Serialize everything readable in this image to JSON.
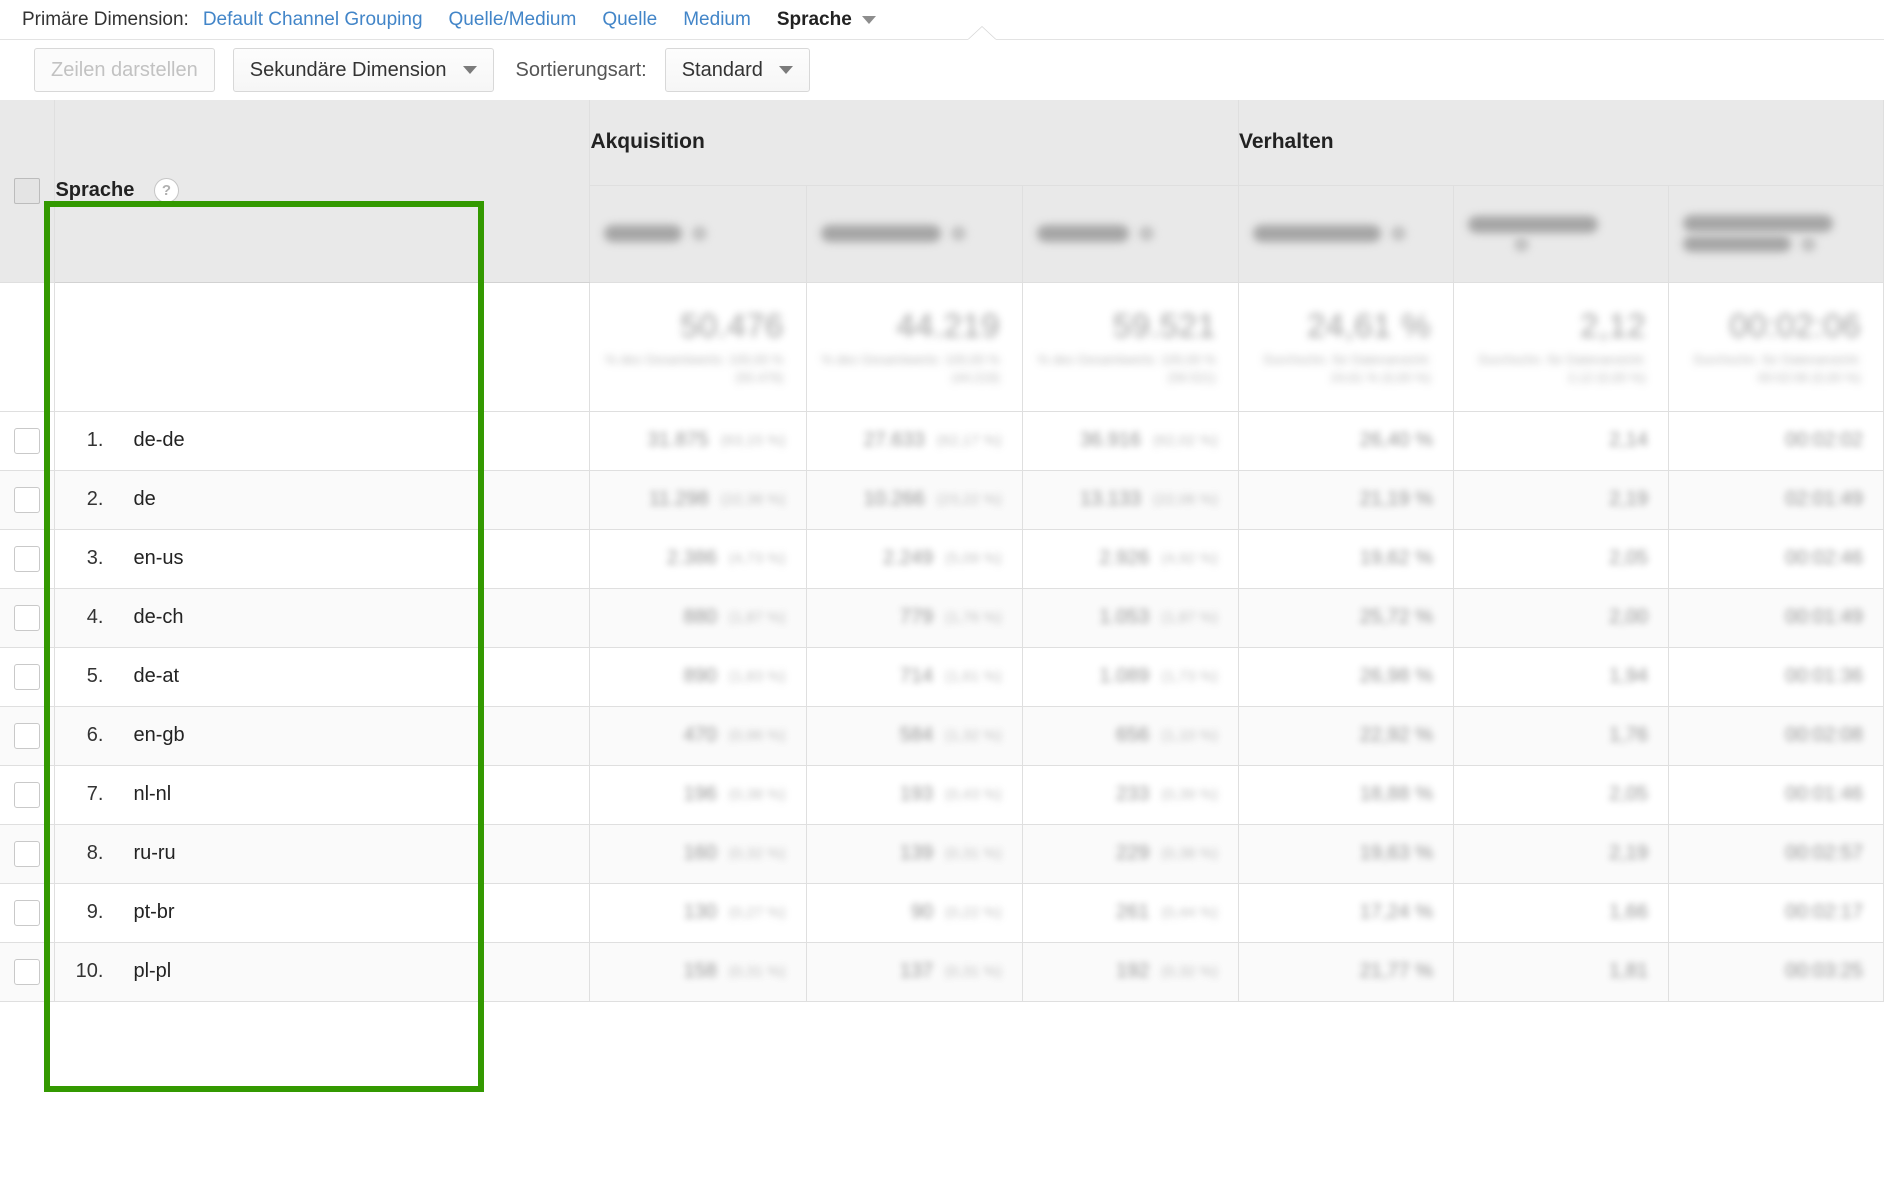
{
  "primary_dimension": {
    "label": "Primäre Dimension:",
    "links": [
      {
        "text": "Default Channel Grouping"
      },
      {
        "text": "Quelle/Medium"
      },
      {
        "text": "Quelle"
      },
      {
        "text": "Medium"
      }
    ],
    "active": "Sprache"
  },
  "toolbar": {
    "rows_button": "Zeilen darstellen",
    "secondary_dimension": "Sekundäre Dimension",
    "sort_label": "Sortierungsart:",
    "sort_value": "Standard"
  },
  "table": {
    "dimension_header": "Sprache",
    "help_glyph": "?",
    "group_headers": [
      {
        "label": "Akquisition"
      },
      {
        "label": "Verhalten"
      }
    ],
    "metric_headers": [
      {
        "name": "metric-1",
        "redacted": true
      },
      {
        "name": "metric-2",
        "redacted": true
      },
      {
        "name": "metric-3",
        "redacted": true
      },
      {
        "name": "metric-4",
        "redacted": true
      },
      {
        "name": "metric-5",
        "redacted": true
      },
      {
        "name": "metric-6",
        "redacted": true
      }
    ],
    "summary": [
      {
        "value": "50.476",
        "note": "% des Gesamtwerts:\n100,00 % (50.476)"
      },
      {
        "value": "44.219",
        "note": "% des Gesamtwerts:\n100,00 % (44.219)"
      },
      {
        "value": "59.521",
        "note": "% des Gesamtwerts:\n100,00 % (59.521)"
      },
      {
        "value": "24,61 %",
        "note": "Durchschn. für\nDatenansicht:\n24,61 % (0,00 %)"
      },
      {
        "value": "2,12",
        "note": "Durchschn. für\nDatenansicht:\n2,12 (0,00 %)"
      },
      {
        "value": "00:02:06",
        "note": "Durchschn. für\nDatenansicht:\n00:02:06 (0,00 %)"
      }
    ],
    "rows": [
      {
        "index": "1.",
        "language": "de-de",
        "cells": [
          {
            "value": "31.875",
            "pct": "(63,15 %)"
          },
          {
            "value": "27.633",
            "pct": "(62,17 %)"
          },
          {
            "value": "36.916",
            "pct": "(62,02 %)"
          },
          {
            "value": "26,40 %",
            "pct": ""
          },
          {
            "value": "2,14",
            "pct": ""
          },
          {
            "value": "00:02:02",
            "pct": ""
          }
        ]
      },
      {
        "index": "2.",
        "language": "de",
        "cells": [
          {
            "value": "11.298",
            "pct": "(22,38 %)"
          },
          {
            "value": "10.266",
            "pct": "(23,22 %)"
          },
          {
            "value": "13.133",
            "pct": "(22,06 %)"
          },
          {
            "value": "21,19 %",
            "pct": ""
          },
          {
            "value": "2,19",
            "pct": ""
          },
          {
            "value": "02:01:49",
            "pct": ""
          }
        ]
      },
      {
        "index": "3.",
        "language": "en-us",
        "cells": [
          {
            "value": "2.386",
            "pct": "(4,73 %)"
          },
          {
            "value": "2.249",
            "pct": "(5,09 %)"
          },
          {
            "value": "2.926",
            "pct": "(4,92 %)"
          },
          {
            "value": "19,62 %",
            "pct": ""
          },
          {
            "value": "2,05",
            "pct": ""
          },
          {
            "value": "00:02:46",
            "pct": ""
          }
        ]
      },
      {
        "index": "4.",
        "language": "de-ch",
        "cells": [
          {
            "value": "880",
            "pct": "(1,87 %)"
          },
          {
            "value": "779",
            "pct": "(1,76 %)"
          },
          {
            "value": "1.053",
            "pct": "(1,87 %)"
          },
          {
            "value": "25,72 %",
            "pct": ""
          },
          {
            "value": "2,00",
            "pct": ""
          },
          {
            "value": "00:01:49",
            "pct": ""
          }
        ]
      },
      {
        "index": "5.",
        "language": "de-at",
        "cells": [
          {
            "value": "890",
            "pct": "(1,83 %)"
          },
          {
            "value": "714",
            "pct": "(1,61 %)"
          },
          {
            "value": "1.089",
            "pct": "(1,73 %)"
          },
          {
            "value": "26,98 %",
            "pct": ""
          },
          {
            "value": "1,94",
            "pct": ""
          },
          {
            "value": "00:01:36",
            "pct": ""
          }
        ]
      },
      {
        "index": "6.",
        "language": "en-gb",
        "cells": [
          {
            "value": "470",
            "pct": "(0,96 %)"
          },
          {
            "value": "584",
            "pct": "(1,32 %)"
          },
          {
            "value": "656",
            "pct": "(1,10 %)"
          },
          {
            "value": "22,92 %",
            "pct": ""
          },
          {
            "value": "1,76",
            "pct": ""
          },
          {
            "value": "00:02:08",
            "pct": ""
          }
        ]
      },
      {
        "index": "7.",
        "language": "nl-nl",
        "cells": [
          {
            "value": "196",
            "pct": "(0,38 %)"
          },
          {
            "value": "193",
            "pct": "(0,43 %)"
          },
          {
            "value": "233",
            "pct": "(0,39 %)"
          },
          {
            "value": "18,88 %",
            "pct": ""
          },
          {
            "value": "2,05",
            "pct": ""
          },
          {
            "value": "00:01:46",
            "pct": ""
          }
        ]
      },
      {
        "index": "8.",
        "language": "ru-ru",
        "cells": [
          {
            "value": "160",
            "pct": "(0,32 %)"
          },
          {
            "value": "139",
            "pct": "(0,31 %)"
          },
          {
            "value": "229",
            "pct": "(0,38 %)"
          },
          {
            "value": "19,63 %",
            "pct": ""
          },
          {
            "value": "2,19",
            "pct": ""
          },
          {
            "value": "00:02:57",
            "pct": ""
          }
        ]
      },
      {
        "index": "9.",
        "language": "pt-br",
        "cells": [
          {
            "value": "130",
            "pct": "(0,27 %)"
          },
          {
            "value": "90",
            "pct": "(0,22 %)"
          },
          {
            "value": "261",
            "pct": "(0,44 %)"
          },
          {
            "value": "17,24 %",
            "pct": ""
          },
          {
            "value": "1,66",
            "pct": ""
          },
          {
            "value": "00:02:17",
            "pct": ""
          }
        ]
      },
      {
        "index": "10.",
        "language": "pl-pl",
        "cells": [
          {
            "value": "158",
            "pct": "(0,31 %)"
          },
          {
            "value": "137",
            "pct": "(0,31 %)"
          },
          {
            "value": "192",
            "pct": "(0,32 %)"
          },
          {
            "value": "21,77 %",
            "pct": ""
          },
          {
            "value": "1,81",
            "pct": ""
          },
          {
            "value": "00:03:25",
            "pct": ""
          }
        ]
      }
    ]
  },
  "highlight": {
    "color": "#339900"
  }
}
